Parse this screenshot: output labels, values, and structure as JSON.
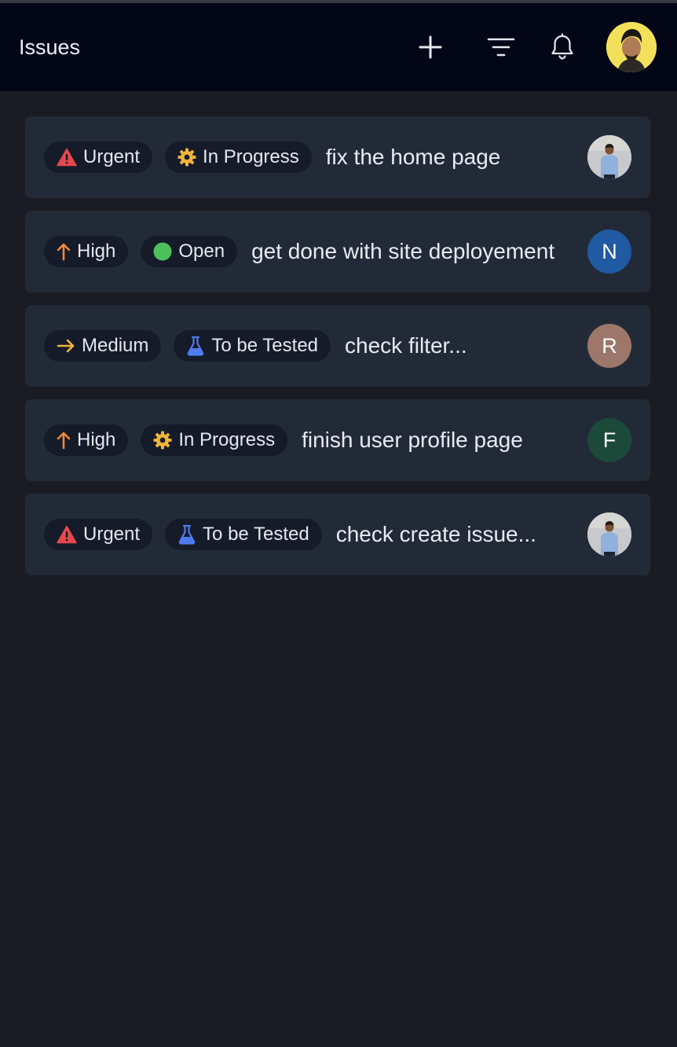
{
  "header": {
    "title": "Issues",
    "icons": [
      "plus-icon",
      "filter-icon",
      "bell-icon"
    ]
  },
  "colors": {
    "urgent": "#e5484d",
    "high": "#ee8a3d",
    "medium": "#f0b43c",
    "in_progress": "#f0b43c",
    "open": "#4cc15b",
    "to_be_tested": "#4f7bf0",
    "avatar_n": "#1f5aa3",
    "avatar_r": "#9c776a",
    "avatar_f": "#1c4a3a",
    "user_avatar_bg": "#f3e05a"
  },
  "issues": [
    {
      "priority": "Urgent",
      "priority_icon": "warning-icon",
      "status": "In Progress",
      "status_icon": "gear-icon",
      "title": "fix the home page",
      "assignee": ""
    },
    {
      "priority": "High",
      "priority_icon": "arrow-up-icon",
      "status": "Open",
      "status_icon": "circle-icon",
      "title": "get done with site deployement",
      "assignee": "N"
    },
    {
      "priority": "Medium",
      "priority_icon": "arrow-right-icon",
      "status": "To be Tested",
      "status_icon": "flask-icon",
      "title": "check filter...",
      "assignee": "R"
    },
    {
      "priority": "High",
      "priority_icon": "arrow-up-icon",
      "status": "In Progress",
      "status_icon": "gear-icon",
      "title": "finish user profile page",
      "assignee": "F"
    },
    {
      "priority": "Urgent",
      "priority_icon": "warning-icon",
      "status": "To be Tested",
      "status_icon": "flask-icon",
      "title": "check create issue...",
      "assignee": ""
    }
  ]
}
